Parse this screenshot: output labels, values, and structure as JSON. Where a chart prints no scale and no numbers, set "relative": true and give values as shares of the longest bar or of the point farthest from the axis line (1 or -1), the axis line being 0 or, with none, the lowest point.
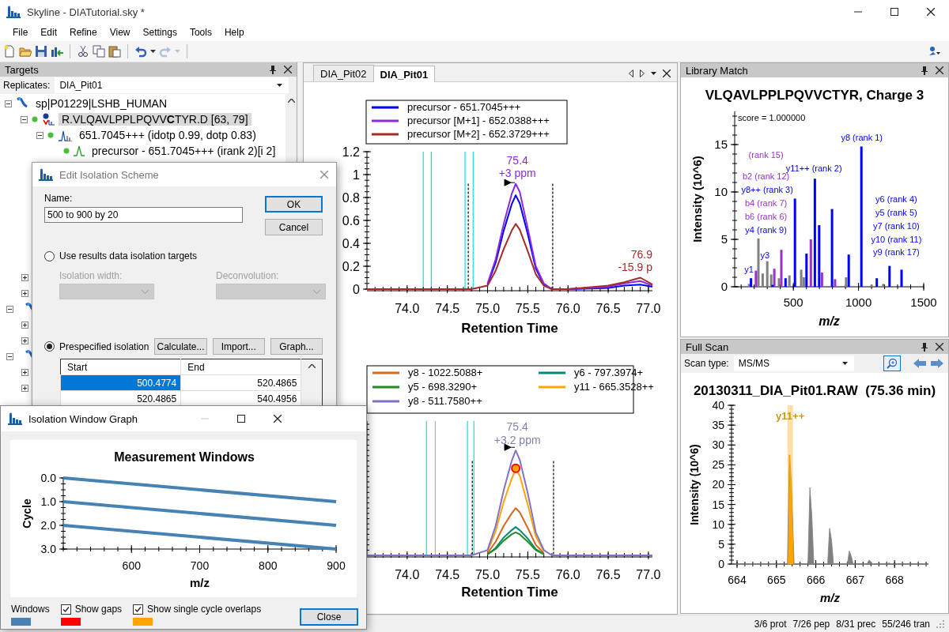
{
  "window": {
    "title": "Skyline - DIATutorial.sky *"
  },
  "menu": [
    "File",
    "Edit",
    "Refine",
    "View",
    "Settings",
    "Tools",
    "Help"
  ],
  "toolbar": [
    {
      "kind": "new",
      "disabled": false
    },
    {
      "kind": "open",
      "disabled": false
    },
    {
      "kind": "save",
      "disabled": false
    },
    {
      "kind": "import",
      "disabled": false
    },
    {
      "kind": "separator"
    },
    {
      "kind": "cut",
      "disabled": false
    },
    {
      "kind": "copy",
      "disabled": false
    },
    {
      "kind": "paste",
      "disabled": false
    },
    {
      "kind": "separator"
    },
    {
      "kind": "undo",
      "disabled": false
    },
    {
      "kind": "dropdown",
      "disabled": false
    },
    {
      "kind": "redo",
      "disabled": true
    },
    {
      "kind": "dropdown",
      "disabled": true
    },
    {
      "kind": "separator"
    },
    {
      "kind": "tools",
      "disabled": false
    }
  ],
  "targets": {
    "title": "Targets",
    "replicates_label": "Replicates:",
    "replicate": "DIA_Pit01",
    "tree": [
      {
        "kind": "protein",
        "label": "sp|P01229|LSHB_HUMAN",
        "expanded": true,
        "selected": false,
        "children": [
          {
            "kind": "peptide",
            "label": "R.VLQAVLPPLPQVV**C**TYR.D [63, 79]",
            "expanded": true,
            "selected": true,
            "children": [
              {
                "kind": "precursor",
                "label": "651.7045+++ (idotp 0.99, dotp 0.83)",
                "expanded": true,
                "selected": false,
                "children": [
                  {
                    "kind": "transition",
                    "label": "precursor - 651.7045+++ (irank 2)[i 2]",
                    "selected": false
                  }
                ]
              }
            ]
          }
        ]
      }
    ],
    "covered_nodes": [
      {
        "kind": "peptide",
        "expanded": false
      },
      {
        "kind": "peptide",
        "expanded": false
      },
      {
        "kind": "protein",
        "expanded": true
      },
      {
        "kind": "peptide",
        "expanded": false
      },
      {
        "kind": "peptide",
        "expanded": false
      },
      {
        "kind": "protein",
        "expanded": true
      },
      {
        "kind": "peptide",
        "expanded": false
      },
      {
        "kind": "peptide",
        "expanded": false
      }
    ]
  },
  "document": {
    "tabs": [
      {
        "label": "DIA_Pit02",
        "selected": false
      },
      {
        "label": "DIA_Pit01",
        "selected": true
      }
    ],
    "charts": [
      {
        "chart_data": {
          "type": "line",
          "xlabel": "Retention Time",
          "x": [
            73.5,
            74.0,
            74.5,
            74.8,
            75.0,
            75.1,
            75.2,
            75.3,
            75.35,
            75.4,
            75.5,
            75.6,
            75.7,
            75.8,
            76.0,
            76.5,
            76.7,
            76.9,
            77.05
          ],
          "xlim": [
            73.5,
            77.05
          ],
          "ylim": [
            0,
            1.2
          ],
          "xticks": [
            {
              "value": 74,
              "label": "74.0"
            },
            {
              "value": 74.5,
              "label": "74.5"
            },
            {
              "value": 75,
              "label": "75.0"
            },
            {
              "value": 75.5,
              "label": "75.5"
            },
            {
              "value": 76,
              "label": "76.0"
            },
            {
              "value": 76.5,
              "label": "76.5"
            },
            {
              "value": 77,
              "label": "77.0"
            }
          ],
          "yticks": [
            0,
            0.2,
            0.4,
            0.6,
            0.8,
            1,
            1.2
          ],
          "legend": "upper left",
          "series": [
            {
              "name": "precursor - 651.7045+++",
              "color": "#0000ff",
              "values": [
                null,
                null,
                null,
                null,
                0.04,
                0.23,
                0.51,
                0.74,
                0.82,
                0.75,
                0.48,
                0.18,
                0.04,
                0,
                0,
                0.01,
                0.03,
                0.04,
                0.02
              ]
            },
            {
              "name": "precursor [M+1] - 652.0388+++",
              "color": "#8a2be2",
              "values": [
                null,
                null,
                null,
                null,
                0.05,
                0.26,
                0.57,
                0.83,
                0.92,
                0.85,
                0.53,
                0.2,
                0.05,
                0,
                0,
                0.02,
                0.05,
                0.07,
                0.03
              ]
            },
            {
              "name": "precursor [M+2] - 652.3729+++",
              "color": "#a52a2a",
              "values": [
                0,
                0,
                0,
                0,
                0.03,
                0.16,
                0.35,
                0.51,
                0.57,
                0.52,
                0.33,
                0.13,
                0.03,
                0,
                0,
                0.03,
                0.06,
                0.1,
                0.04
              ]
            }
          ],
          "ref_lines": [
            {
              "axis": "x",
              "value": 74.2,
              "color": "#00e5ee"
            },
            {
              "axis": "x",
              "value": 74.3,
              "color": "#00e5ee"
            },
            {
              "axis": "x",
              "value": 74.72,
              "color": "#00e5ee"
            },
            {
              "axis": "x",
              "value": 74.82,
              "color": "#00e5ee"
            },
            {
              "axis": "x",
              "value": 74.76,
              "color": "#000000"
            },
            {
              "axis": "x",
              "value": 75.81,
              "color": "#000000"
            }
          ],
          "annotations": [
            "75.4",
            "+3 ppm",
            "76.9",
            "-15.9 p"
          ]
        }
      },
      {
        "chart_data": {
          "type": "line",
          "xlabel": "Retention Time",
          "relative": true,
          "x": [
            73.5,
            74.0,
            74.5,
            74.8,
            75.0,
            75.1,
            75.2,
            75.3,
            75.35,
            75.4,
            75.5,
            75.6,
            75.7,
            75.8,
            76.0,
            76.5,
            76.7,
            76.9,
            77.05
          ],
          "xlim": [
            73.5,
            77.05
          ],
          "xticks": [
            {
              "value": 74,
              "label": "74.0"
            },
            {
              "value": 74.5,
              "label": "74.5"
            },
            {
              "value": 75,
              "label": "75.0"
            },
            {
              "value": 75.5,
              "label": "75.5"
            },
            {
              "value": 76,
              "label": "76.0"
            },
            {
              "value": 76.5,
              "label": "76.5"
            },
            {
              "value": 77,
              "label": "77.0"
            }
          ],
          "legend": "upper left",
          "series": [
            {
              "name": "y8 - 1022.5088+",
              "color": "#d2691e",
              "values": [
                null,
                null,
                null,
                null,
                0.02,
                0.13,
                0.28,
                0.4,
                0.45,
                0.41,
                0.26,
                0.1,
                0.02,
                null,
                null,
                null,
                null,
                null,
                null
              ]
            },
            {
              "name": "y6 - 797.3974+",
              "color": "#008b7a",
              "values": [
                null,
                null,
                null,
                null,
                0.01,
                0.07,
                0.17,
                0.24,
                0.27,
                0.24,
                0.16,
                0.06,
                0.01,
                null,
                null,
                null,
                null,
                null,
                null
              ]
            },
            {
              "name": "y5 - 698.3290+",
              "color": "#228b22",
              "values": [
                null,
                null,
                null,
                null,
                0.01,
                0.06,
                0.14,
                0.2,
                0.22,
                0.2,
                0.13,
                0.05,
                0.01,
                null,
                null,
                null,
                null,
                null,
                null
              ]
            },
            {
              "name": "y11 - 665.3528++",
              "color": "#ffa500",
              "values": [
                null,
                null,
                null,
                null,
                0.04,
                0.23,
                0.51,
                0.73,
                0.82,
                0.76,
                0.48,
                0.18,
                0.04,
                null,
                null,
                null,
                null,
                null,
                null
              ]
            },
            {
              "name": "y8 - 511.7580++",
              "color": "#8470c8",
              "values": [
                0,
                0,
                0,
                0,
                0.05,
                0.28,
                0.62,
                0.9,
                1,
                0.91,
                0.59,
                0.22,
                0.05,
                0,
                0,
                0,
                0,
                0,
                0
              ]
            }
          ],
          "ref_lines": [
            {
              "axis": "x",
              "value": 74.24,
              "color": "#00e5ee"
            },
            {
              "axis": "x",
              "value": 74.35,
              "color": "#b0b0b0"
            },
            {
              "axis": "x",
              "value": 74.75,
              "color": "#00e5ee"
            },
            {
              "axis": "x",
              "value": 74.83,
              "color": "#00e5ee"
            },
            {
              "axis": "x",
              "value": 74.81,
              "color": "#000000"
            },
            {
              "axis": "x",
              "value": 75.82,
              "color": "#000000"
            }
          ],
          "annotations": [
            "75.4",
            "+3.2 ppm"
          ]
        }
      }
    ]
  },
  "library_match": {
    "title": "Library Match",
    "chart_data": {
      "type": "bar",
      "title": "VLQAVLPPLPQVVCTYR, Charge 3",
      "xlabel": "m/z",
      "ylabel": "Intensity (10^6)",
      "xlim": [
        50,
        1500
      ],
      "ylim": [
        0,
        18.5
      ],
      "xticks": [
        500,
        1000,
        1500
      ],
      "yticks": [
        0,
        5,
        10,
        15
      ],
      "series": [
        {
          "color": "#808080",
          "x": [
            160,
            232,
            265,
            300,
            330,
            390,
            470,
            560,
            580,
            905,
            1100,
            1190
          ],
          "values": [
            0.3,
            5.1,
            1.4,
            2.7,
            1.3,
            0.9,
            1.2,
            1.8,
            1.0,
            1.0,
            0.2,
            0.3
          ]
        },
        {
          "color": "#9932cc",
          "x": [
            213,
            354,
            408,
            634,
            720,
            820
          ],
          "values": [
            1.7,
            1.9,
            3.9,
            5.0,
            1.5,
            0.8
          ]
        },
        {
          "color": "#0000ff",
          "x": [
            175,
            340,
            440,
            512,
            601,
            665,
            698,
            797,
            925,
            1022,
            1140,
            1238,
            1330
          ],
          "values": [
            0.9,
            0.2,
            0.9,
            9.3,
            3.5,
            11.4,
            6.5,
            8.2,
            3.4,
            14.8,
            0.9,
            2.2,
            1.8
          ]
        }
      ],
      "annotations": [
        "score = 1.000000",
        "y8 (rank 1)",
        "y11++ (rank 2)",
        "y8++ (rank 3)",
        "y6 (rank 4)",
        "y5 (rank 5)",
        "b6 (rank 6)",
        "b4 (rank 7)",
        "y4 (rank 9)",
        "y7 (rank 10)",
        "y10 (rank 11)",
        "b2 (rank 12)",
        "(rank 15)",
        "y1",
        "y3",
        "y9 (rank 17)"
      ]
    }
  },
  "full_scan": {
    "title": "Full Scan",
    "scan_type_label": "Scan type:",
    "scan_type": "MS/MS",
    "zoom_selected": true,
    "chart_data": {
      "type": "area",
      "title": "20130311_DIA_Pit01.RAW  (75.36 min)",
      "xlabel": "m/z",
      "ylabel": "Intensity (10^6)",
      "xlim": [
        663.86,
        668.86
      ],
      "ylim": [
        0,
        40
      ],
      "xticks": [
        664,
        665,
        666,
        667,
        668
      ],
      "yticks": [
        0,
        5,
        10,
        15,
        20,
        25,
        30,
        35,
        40
      ],
      "series": [
        {
          "color": "#808080",
          "x": [
            663.86,
            665.28,
            665.33,
            665.38,
            665.45,
            665.8,
            665.85,
            665.9,
            665.95,
            666.3,
            666.35,
            666.4,
            666.45,
            666.8,
            666.85,
            666.9,
            666.95,
            667.3,
            667.35,
            667.4,
            667.45,
            667.8,
            667.86,
            667.92,
            668.86
          ],
          "values": [
            0,
            0,
            27.5,
            20,
            0,
            0,
            19.3,
            12,
            0,
            0,
            9,
            6,
            0,
            0,
            3.3,
            2,
            0,
            0,
            1,
            0.6,
            0,
            0,
            0.3,
            0,
            0
          ]
        },
        {
          "color": "#ffa500",
          "x": [
            665.3,
            665.34,
            665.38,
            665.43
          ],
          "values": [
            0,
            27.5,
            19.5,
            0
          ]
        }
      ],
      "bands": [
        {
          "axis": "x",
          "from": 665.28,
          "to": 665.42
        }
      ],
      "annotations": [
        "y11++"
      ]
    }
  },
  "status_bar": [
    "3/6 prot",
    "7/26 pep",
    "8/31 prec",
    "55/246 tran"
  ],
  "isolation_scheme_dialog": {
    "title": "Edit Isolation Scheme",
    "name_label": "Name:",
    "name_value": "500 to 900 by 20",
    "ok": "OK",
    "cancel": "Cancel",
    "options": [
      {
        "label": "Use results data isolation targets",
        "selected": false
      },
      {
        "label": "Prespecified isolation",
        "selected": true
      }
    ],
    "results_fields": [
      {
        "label": "Isolation width:",
        "disabled": true
      },
      {
        "label": "Deconvolution:",
        "disabled": true
      }
    ],
    "action_buttons": [
      "Calculate...",
      "Import...",
      "Graph..."
    ],
    "table": {
      "columns": [
        "Start",
        "End"
      ],
      "rows": [
        {
          "cells": [
            "500.4774",
            "520.4865"
          ],
          "selected": true
        },
        {
          "cells": [
            "520.4865",
            "540.4956"
          ],
          "selected": false
        }
      ]
    }
  },
  "isolation_graph_dialog": {
    "title": "Isolation Window Graph",
    "minimize_disabled": true,
    "chart_data": {
      "type": "line",
      "title": "Measurement Windows",
      "xlabel": "m/z",
      "ylabel": "Cycle",
      "x": [
        500,
        900
      ],
      "xlim": [
        500,
        900
      ],
      "ylim": [
        3,
        0
      ],
      "xticks": [
        600,
        700,
        800,
        900
      ],
      "yticks": [
        {
          "value": 0,
          "label": "0.0"
        },
        {
          "value": 1,
          "label": "1.0"
        },
        {
          "value": 2,
          "label": "2.0"
        },
        {
          "value": 3,
          "label": "3.0"
        }
      ],
      "series": [
        {
          "color": "#4682b4",
          "values": [
            0,
            1
          ]
        },
        {
          "color": "#4682b4",
          "values": [
            1,
            2
          ]
        },
        {
          "color": "#4682b4",
          "values": [
            2,
            3
          ]
        }
      ]
    },
    "legend": [
      {
        "kind": "label",
        "label": "Windows",
        "color": "#4682b4"
      },
      {
        "kind": "checkbox",
        "label": "Show gaps",
        "checked": true,
        "color": "#ff0000"
      },
      {
        "kind": "checkbox",
        "label": "Show single cycle overlaps",
        "checked": true,
        "color": "#ffa500"
      }
    ],
    "close_button": "Close"
  }
}
